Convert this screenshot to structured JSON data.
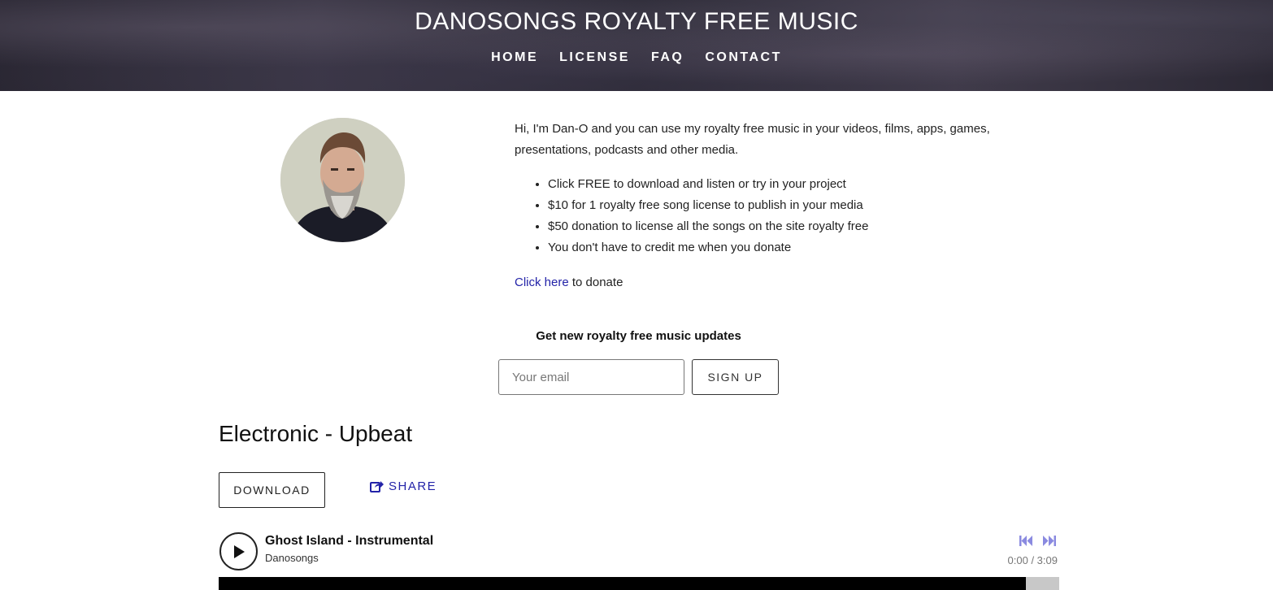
{
  "header": {
    "title": "DANOSONGS ROYALTY FREE MUSIC",
    "nav": [
      "HOME",
      "LICENSE",
      "FAQ",
      "CONTACT"
    ]
  },
  "intro": {
    "text": "Hi, I'm Dan-O and you can use my royalty free music in your videos, films, apps, games, presentations, podcasts and other media.",
    "bullets": [
      "Click FREE to download and listen or try in your project",
      "$10 for 1 royalty free song license to publish in your media",
      "$50 donation to license all the songs on the site royalty free",
      "You don't have to credit me when you donate"
    ],
    "donate_link": "Click here",
    "donate_suffix": " to donate"
  },
  "signup": {
    "title": "Get new royalty free music updates",
    "email_placeholder": "Your email",
    "button": "SIGN UP"
  },
  "section": {
    "title": "Electronic - Upbeat",
    "download": "DOWNLOAD",
    "share": "SHARE"
  },
  "player": {
    "track_title": "Ghost Island - Instrumental",
    "artist": "Danosongs",
    "time": "0:00 / 3:09",
    "buffered_fraction": 0.96,
    "accent_color": "#8a8ae0"
  }
}
